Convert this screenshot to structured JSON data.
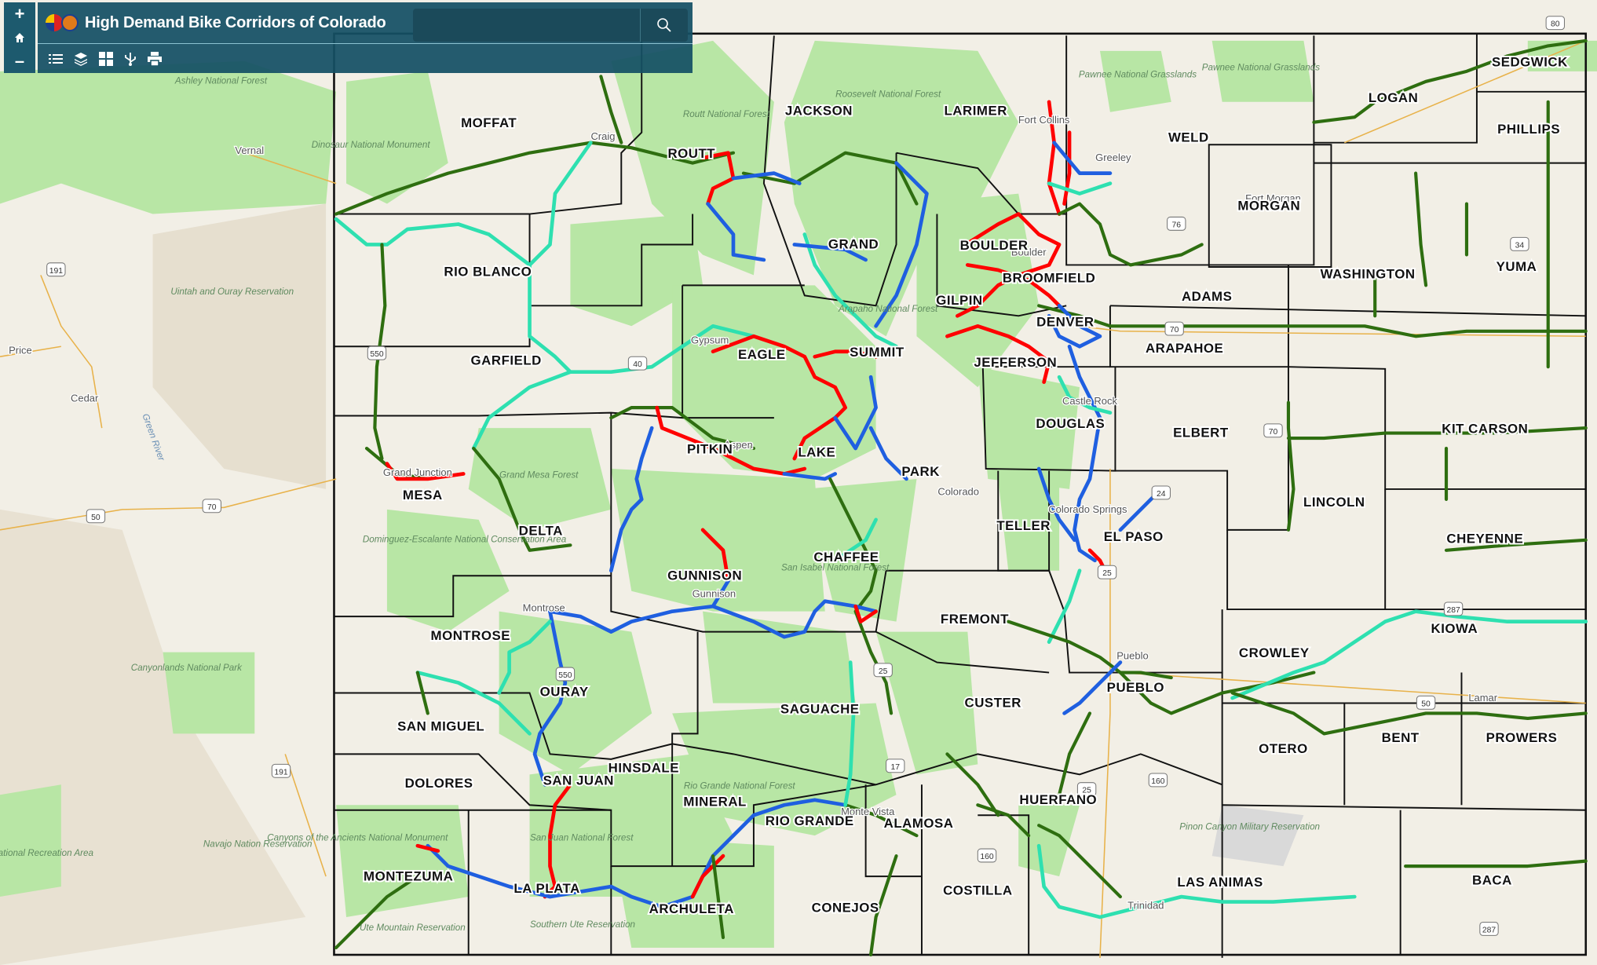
{
  "app": {
    "title": "High Demand Bike Corridors of Colorado"
  },
  "search": {
    "placeholder": "",
    "value": ""
  },
  "zoom": {
    "in": "+",
    "out": "–"
  },
  "toolbar": [
    "list-icon",
    "layers-icon",
    "basemap-gallery-icon",
    "share-icon",
    "print-icon"
  ],
  "colors": {
    "header": "#145064",
    "high": "#ff0000",
    "medium": "#1f5fe0",
    "low": "#2e6e10",
    "other": "#2ee0b0",
    "forest": "#b8e6a5",
    "land": "#f2efe6"
  },
  "counties": [
    "MOFFAT",
    "JACKSON",
    "LARIMER",
    "WELD",
    "LOGAN",
    "SEDGWICK",
    "PHILLIPS",
    "ROUTT",
    "MORGAN",
    "GRAND",
    "BOULDER",
    "RIO BLANCO",
    "BROOMFIELD",
    "WASHINGTON",
    "YUMA",
    "ADAMS",
    "GILPIN",
    "DENVER",
    "GARFIELD",
    "EAGLE",
    "SUMMIT",
    "JEFFERSON",
    "ARAPAHOE",
    "DOUGLAS",
    "ELBERT",
    "KIT CARSON",
    "PITKIN",
    "LAKE",
    "PARK",
    "MESA",
    "LINCOLN",
    "TELLER",
    "EL PASO",
    "DELTA",
    "CHEYENNE",
    "CHAFFEE",
    "GUNNISON",
    "FREMONT",
    "MONTROSE",
    "KIOWA",
    "CROWLEY",
    "OURAY",
    "PUEBLO",
    "CUSTER",
    "SAGUACHE",
    "SAN MIGUEL",
    "BENT",
    "PROWERS",
    "OTERO",
    "HINSDALE",
    "SAN JUAN",
    "DOLORES",
    "MINERAL",
    "HUERFANO",
    "RIO GRANDE",
    "ALAMOSA",
    "MONTEZUMA",
    "LAS ANIMAS",
    "BACA",
    "LA PLATA",
    "COSTILLA",
    "ARCHULETA",
    "CONEJOS"
  ],
  "places": [
    "Vernal",
    "Price",
    "Cedar",
    "Fort Collins",
    "Greeley",
    "Craig",
    "Gypsum",
    "Boulder",
    "Castle Rock",
    "Grand Junction",
    "Montrose",
    "Gunnison",
    "Colorado Springs",
    "Pueblo",
    "Monte Vista",
    "Trinidad",
    "Lamar",
    "Fort Morgan",
    "Colorado",
    "Aspen"
  ],
  "forests": [
    "Ashley National Forest",
    "Dinosaur National Monument",
    "Uintah and Ouray Reservation",
    "Routt National Forest",
    "Roosevelt National Forest",
    "Pawnee National Grasslands",
    "Pawnee National Grasslands",
    "Arapaho National Forest",
    "Grand Mesa Forest",
    "Dominguez-Escalante National Conservation Area",
    "Canyonlands National Park",
    "Navajo Nation Reservation",
    "Canyons of the Ancients National Monument",
    "Ute Mountain Reservation",
    "San Juan National Forest",
    "Southern Ute Reservation",
    "Rio Grande National Forest",
    "San Isabel National Forest",
    "Pinon Canyon Military Reservation",
    "Green River",
    "Canyon National Recreation Area"
  ],
  "shields": [
    "191",
    "191",
    "50",
    "70",
    "70",
    "76",
    "34",
    "70",
    "24",
    "25",
    "287",
    "287",
    "50",
    "160",
    "160",
    "25",
    "17",
    "550",
    "550",
    "40",
    "80",
    "25"
  ]
}
